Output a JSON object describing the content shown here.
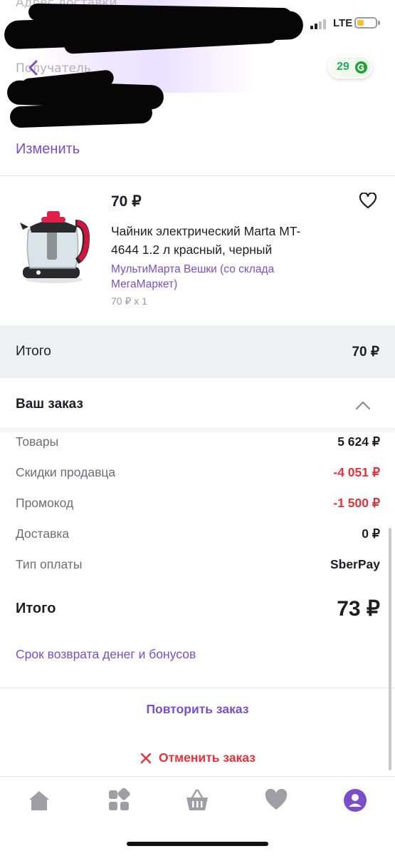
{
  "header": {
    "faded_address_label": "Адрес доставки",
    "recipient_label": "Получатель",
    "change_link": "Изменить",
    "bonus_count": "29"
  },
  "status_bar": {
    "network": "LTE"
  },
  "product": {
    "price": "70 ₽",
    "title": "Чайник электрический Marta MT-4644 1.2 л красный, черный",
    "seller": "МультиМарта Вешки (со склада МегаМаркет)",
    "quantity_line": "70 ₽ x 1"
  },
  "total_band": {
    "label": "Итого",
    "value": "70 ₽"
  },
  "order": {
    "heading": "Ваш заказ",
    "rows": [
      {
        "label": "Товары",
        "value": "5 624 ₽"
      },
      {
        "label": "Скидки продавца",
        "value": "-4 051 ₽"
      },
      {
        "label": "Промокод",
        "value": "-1 500 ₽"
      },
      {
        "label": "Доставка",
        "value": "0 ₽"
      },
      {
        "label": "Тип оплаты",
        "value": "SberPay"
      }
    ],
    "grand_label": "Итого",
    "grand_value": "73 ₽",
    "refund_link": "Срок возврата денег и бонусов",
    "repeat_button": "Повторить заказ",
    "cancel_button": "Отменить заказ"
  },
  "colors": {
    "accent": "#7a4ec8",
    "danger": "#e3323b",
    "bonus_green": "#21a038"
  },
  "tabbar": {
    "icons": [
      "home-icon",
      "catalog-icon",
      "cart-icon",
      "favorites-icon",
      "profile-icon"
    ],
    "active": "profile-icon"
  }
}
